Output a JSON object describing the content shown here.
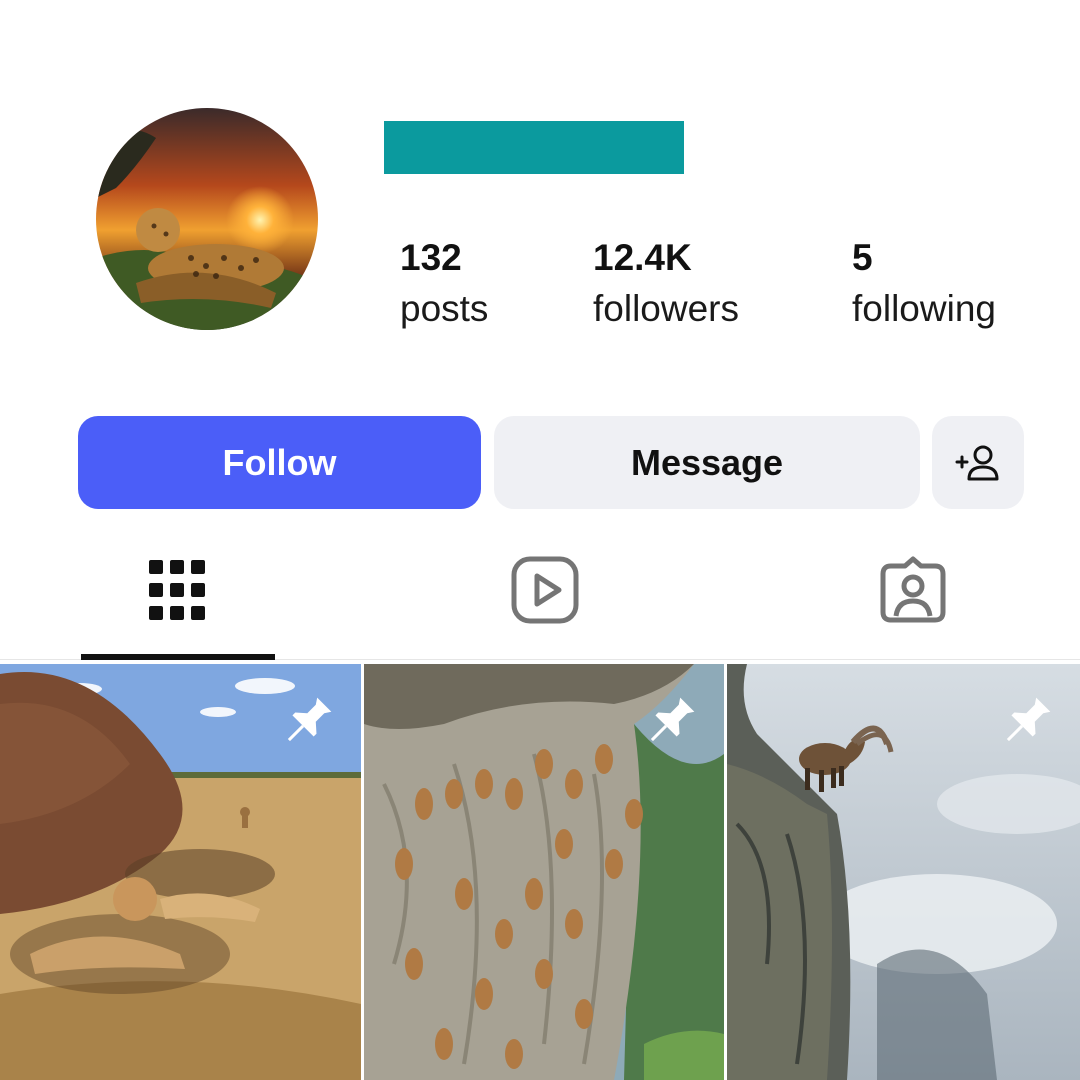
{
  "profile": {
    "avatar_icon": "leopard-sunset-avatar",
    "name_redaction_color": "#0b9a9e",
    "stats": {
      "posts": {
        "count": "132",
        "label": "posts"
      },
      "followers": {
        "count": "12.4K",
        "label": "followers"
      },
      "following": {
        "count": "5",
        "label": "following"
      }
    }
  },
  "actions": {
    "follow_label": "Follow",
    "message_label": "Message",
    "add_user_icon": "add-person-icon"
  },
  "tabs": [
    {
      "name": "posts-grid",
      "icon": "grid-icon",
      "active": true
    },
    {
      "name": "reels",
      "icon": "reels-icon",
      "active": false
    },
    {
      "name": "tagged",
      "icon": "tagged-person-icon",
      "active": false
    }
  ],
  "posts": [
    {
      "scene": "lions-under-rock",
      "pinned": true,
      "pin_icon": "pin-icon"
    },
    {
      "scene": "ibex-herd-on-cliff",
      "pinned": true,
      "pin_icon": "pin-icon"
    },
    {
      "scene": "ibex-on-cliff-edge",
      "pinned": true,
      "pin_icon": "pin-icon"
    }
  ],
  "colors": {
    "follow_bg": "#4b5ef8",
    "secondary_bg": "#eff0f4",
    "active_tab": "#111111",
    "inactive_tab": "#757575"
  }
}
